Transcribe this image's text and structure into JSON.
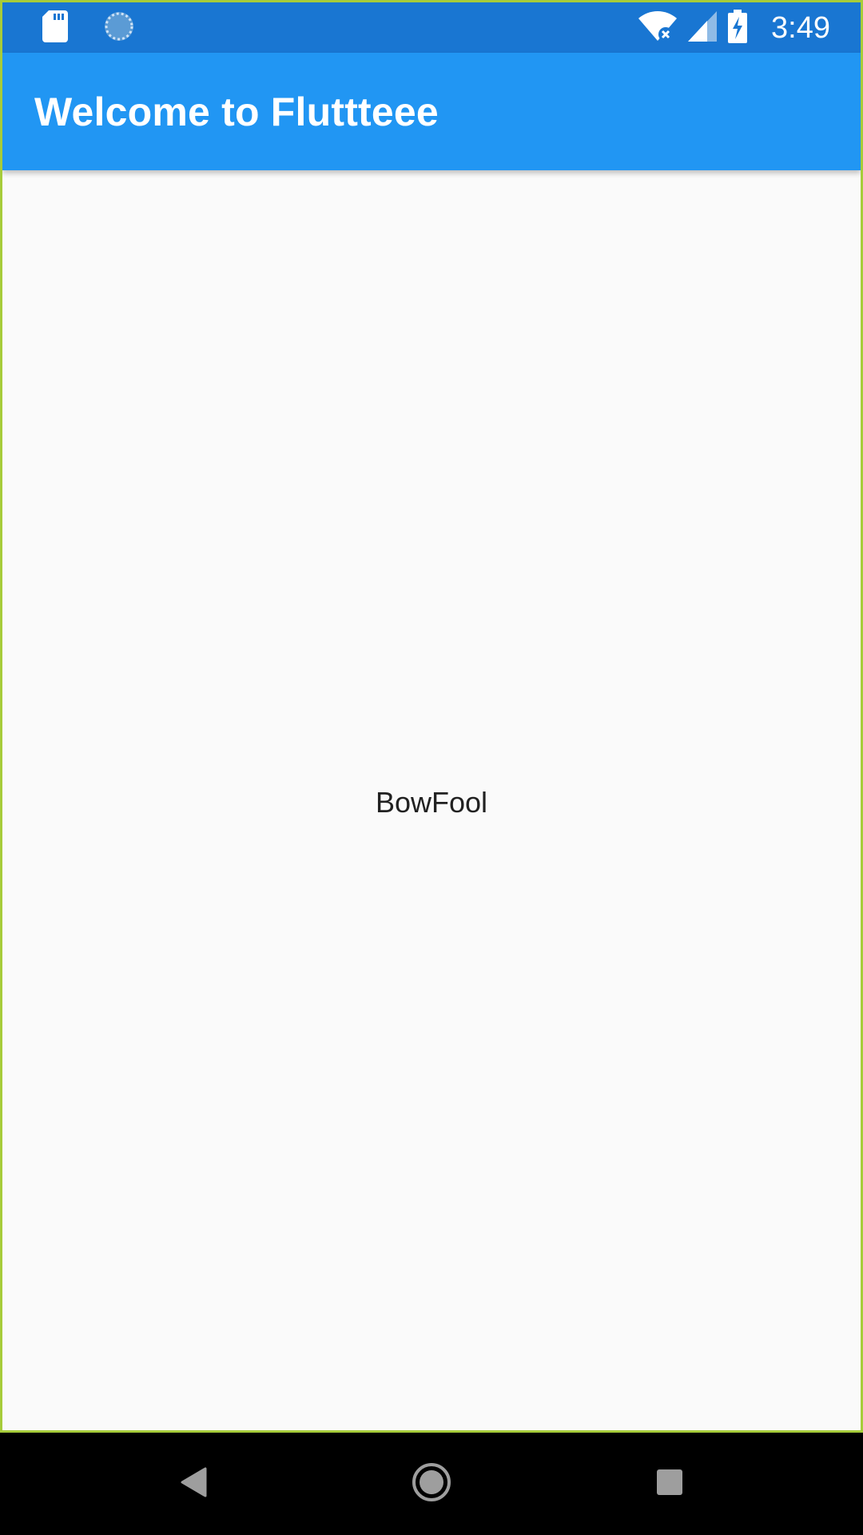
{
  "status_bar": {
    "time": "3:49",
    "icons": [
      "sd-card-icon",
      "loading-spinner-icon",
      "wifi-off-icon",
      "cell-signal-icon",
      "battery-charging-icon"
    ]
  },
  "app_bar": {
    "title": "Welcome to Fluttteee"
  },
  "main": {
    "center_text": "BowFool"
  },
  "nav_bar": {
    "buttons": [
      "back-icon",
      "home-icon",
      "recents-icon"
    ]
  },
  "colors": {
    "status_bar": "#1976d2",
    "app_bar": "#2196f3",
    "background": "#fafafa",
    "text": "#212121",
    "frame_border": "#a6cc3a"
  }
}
